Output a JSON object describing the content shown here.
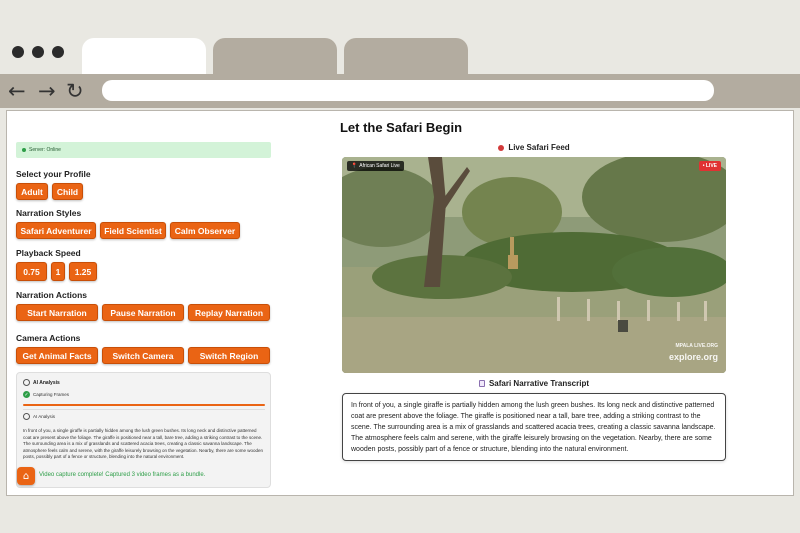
{
  "page": {
    "title": "Let the Safari Begin"
  },
  "status": {
    "text": "Server: Online"
  },
  "profile": {
    "label": "Select your Profile",
    "options": [
      "Adult",
      "Child"
    ]
  },
  "narration_styles": {
    "label": "Narration Styles",
    "options": [
      "Safari Adventurer",
      "Field Scientist",
      "Calm Observer"
    ]
  },
  "playback_speed": {
    "label": "Playback Speed",
    "options": [
      "0.75",
      "1",
      "1.25"
    ]
  },
  "narration_actions": {
    "label": "Narration Actions",
    "options": [
      "Start Narration",
      "Pause Narration",
      "Replay Narration"
    ]
  },
  "camera_actions": {
    "label": "Camera Actions",
    "options": [
      "Get Animal Facts",
      "Switch Camera",
      "Switch Region"
    ]
  },
  "analysis": {
    "title": "AI Analysis",
    "step1": "Capturing Frames",
    "step2": "AI Analysis",
    "progress": 1.0,
    "text": "In front of you, a single giraffe is partially hidden among the lush green bushes. Its long neck and distinctive patterned coat are present above the foliage. The giraffe is positioned near a tall, bare tree, adding a striking contrast to the scene. The surrounding area is a mix of grasslands and scattered acacia trees, creating a classic savanna landscape. The atmosphere feels calm and serene, with the giraffe leisurely browsing on the vegetation. Nearby, there are some wooden posts, possibly part of a fence or structure, blending into the natural environment.",
    "success": "Video capture complete! Captured 3 video frames as a bundle."
  },
  "feed": {
    "label": "Live Safari Feed",
    "badge": "African Safari Live",
    "live": "• LIVE",
    "watermark1": "MPALA LIVE.ORG",
    "watermark2": "explore.org"
  },
  "transcript": {
    "label": "Safari Narrative Transcript",
    "text": "In front of you, a single giraffe is partially hidden among the lush green bushes. Its long neck and distinctive patterned coat are present above the foliage. The giraffe is positioned near a tall, bare tree, adding a striking contrast to the scene. The surrounding area is a mix of grasslands and scattered acacia trees, creating a classic savanna landscape. The atmosphere feels calm and serene, with the giraffe leisurely browsing on the vegetation. Nearby, there are some wooden posts, possibly part of a fence or structure, blending into the natural environment."
  },
  "colors": {
    "accent": "#ea6414",
    "success": "#2e9e48",
    "live": "#e03232"
  },
  "icons": [
    "back-arrow-icon",
    "forward-arrow-icon",
    "reload-icon",
    "status-dot-icon",
    "eye-icon",
    "check-icon",
    "red-dot-icon",
    "transcript-icon",
    "home-icon",
    "pin-icon"
  ]
}
